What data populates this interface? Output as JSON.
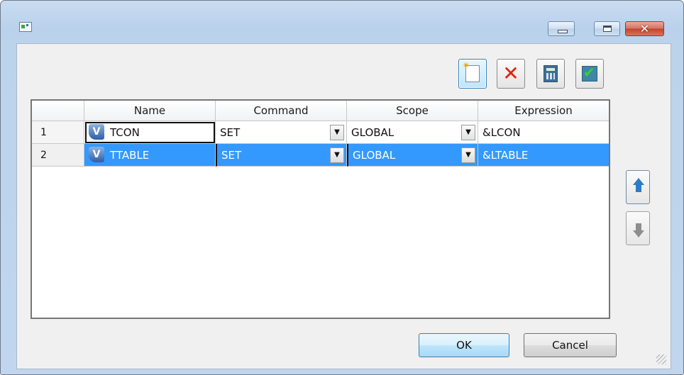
{
  "window": {
    "title": "",
    "controls": {
      "minimize": "minimize",
      "maximize": "maximize",
      "close": "✕"
    }
  },
  "toolbar": {
    "buttons": [
      {
        "icon": "new-document-icon",
        "action": "new"
      },
      {
        "icon": "delete-icon",
        "action": "delete"
      },
      {
        "icon": "calculator-icon",
        "action": "calculate"
      },
      {
        "icon": "check-icon",
        "action": "validate"
      }
    ]
  },
  "grid": {
    "columns": [
      "Name",
      "Command",
      "Scope",
      "Expression"
    ],
    "rows": [
      {
        "num": "1",
        "name": "TCON",
        "badge": "V",
        "command": "SET",
        "scope": "GLOBAL",
        "expression": "&LCON",
        "selected": false
      },
      {
        "num": "2",
        "name": "TTABLE",
        "badge": "V",
        "command": "SET",
        "scope": "GLOBAL",
        "expression": "&LTABLE",
        "selected": true
      }
    ],
    "dropdown_arrow": "▼"
  },
  "side": {
    "move_up_icon": "arrow-up-icon",
    "move_down_icon": "arrow-down-icon"
  },
  "footer": {
    "ok": "OK",
    "cancel": "Cancel"
  },
  "colors": {
    "selection": "#3399ff",
    "frame": "#bcd3ec",
    "close_button": "#c2432b"
  }
}
